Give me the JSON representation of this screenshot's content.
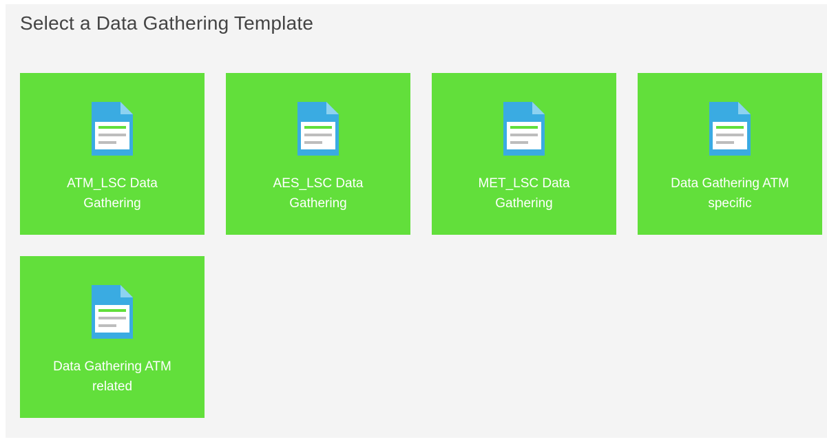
{
  "page": {
    "title": "Select a Data Gathering Template"
  },
  "colors": {
    "tile_background": "#62df3b",
    "panel_background": "#f4f4f4",
    "icon_body": "#3aabe2",
    "icon_fold": "#8dd2f0",
    "icon_card": "#ffffff",
    "icon_green_line": "#62df3b",
    "icon_grey_line": "#bdbdbd"
  },
  "templates": [
    {
      "label": "ATM_LSC Data Gathering",
      "icon": "document-icon"
    },
    {
      "label": "AES_LSC Data Gathering",
      "icon": "document-icon"
    },
    {
      "label": "MET_LSC Data Gathering",
      "icon": "document-icon"
    },
    {
      "label": "Data Gathering ATM specific",
      "icon": "document-icon"
    },
    {
      "label": "Data Gathering ATM related",
      "icon": "document-icon"
    }
  ]
}
